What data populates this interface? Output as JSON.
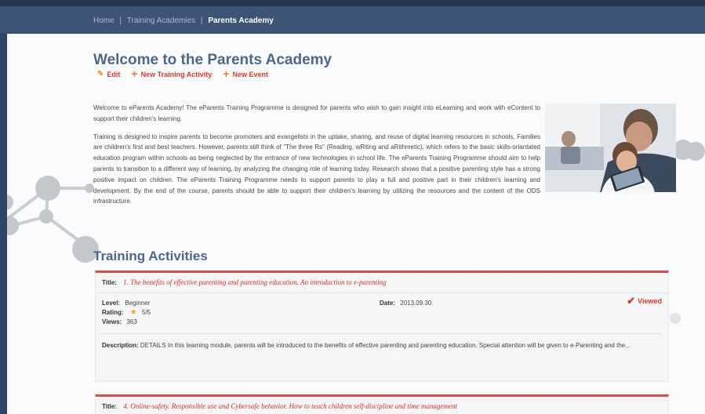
{
  "breadcrumb": {
    "home": "Home",
    "separator": "|",
    "training_academies": "Training Academies",
    "current": "Parents Academy"
  },
  "page": {
    "title": "Welcome to the Parents Academy",
    "actions": {
      "edit": "Edit",
      "new_activity": "New Training Activity",
      "new_event": "New Event"
    },
    "intro": [
      "Welcome to eParents Academy! The eParents Training Programme is designed for parents who wish to gain insight into eLearning and work with eContent to support their children's learning.",
      "Training is designed to inspire parents to become promoters and evangelists in the uptake, sharing, and reuse of digital learning resources in schools. Families are children's first and best teachers. However, parents still think of \"The three Rs\" (Reading, wRiting and aRithmetic), which refers to the basic skills-oriantated education program within schools as being neglected by the entrance of new technologies in school life. The eParents Training Programme should aim to help parents to transition to a different way of learning, by analyzing the changing role of learning today. Research shows that a positive parenting style has a strong positive impact on children. The eParents Training Programme needs to support parents to play a full and positive part in their children's learning and development. By the end of the course, parents should be able to support their children's learning by utilizing the resources and the content of the ODS infrastructure."
    ]
  },
  "section": {
    "title": "Training Activities"
  },
  "labels": {
    "title": "Title:",
    "level": "Level:",
    "rating": "Rating:",
    "views": "Views:",
    "date": "Date:",
    "description": "Description:",
    "viewed": "Viewed"
  },
  "activities": [
    {
      "title": "1. The benefits of effective parenting and parenting education. An introduction to e-parenting",
      "level": "Beginner",
      "rating": "5/5",
      "views": "363",
      "date": "2013.09.30",
      "description": "DETAILS In this learning module, parents will be introduced to the benefits of effective parenting and parenting education. Special attention will be given to e-Parenting and the..."
    },
    {
      "title": "4. Online-safety. Responsible use and Cybersafe behavior. How to teach children self-discipline and time management"
    }
  ],
  "icons": {
    "edit": "pencil-icon",
    "add": "plus-icon",
    "viewed": "checkmark-icon",
    "rating": "star-icon"
  },
  "colors": {
    "header": "#3e5475",
    "title": "#4d678a",
    "accent_red": "#d83a26",
    "card_border": "#e54a3b"
  }
}
